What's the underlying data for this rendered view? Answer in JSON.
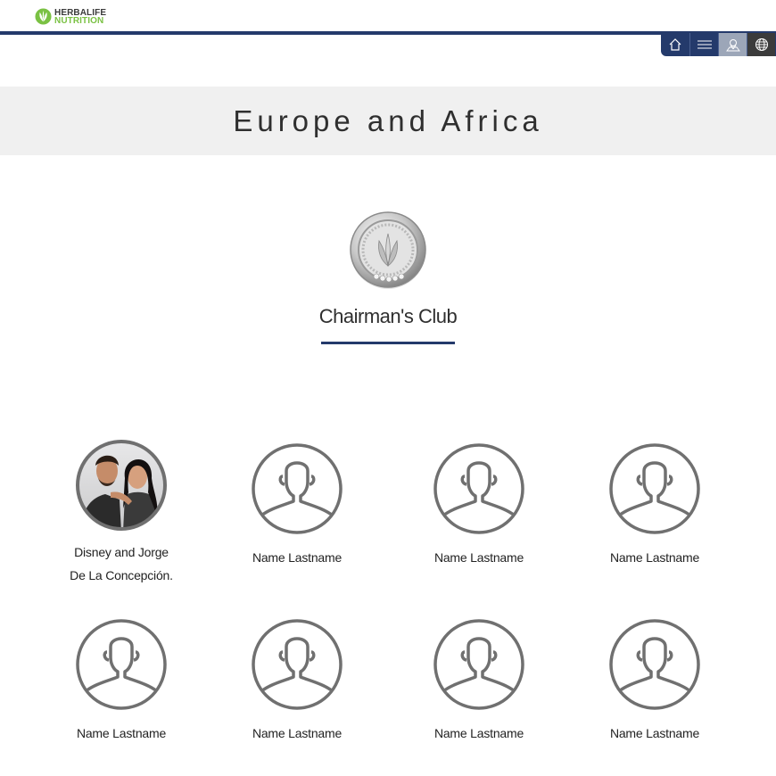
{
  "brand": {
    "line1": "HERBALIFE",
    "line2": "NUTRITION",
    "accent_color": "#7ac143",
    "nav_color": "#243a6b"
  },
  "nav": {
    "items": [
      {
        "icon": "home-icon"
      },
      {
        "icon": "menu-icon"
      },
      {
        "icon": "map-pin-icon"
      },
      {
        "icon": "globe-icon"
      }
    ]
  },
  "banner": {
    "title": "Europe and Africa"
  },
  "club": {
    "title": "Chairman's Club"
  },
  "members": [
    {
      "name_line1": "Disney and Jorge",
      "name_line2": "De La Concepción.",
      "has_photo": true
    },
    {
      "name_line1": "Name Lastname",
      "name_line2": "",
      "has_photo": false
    },
    {
      "name_line1": "Name Lastname",
      "name_line2": "",
      "has_photo": false
    },
    {
      "name_line1": "Name Lastname",
      "name_line2": "",
      "has_photo": false
    },
    {
      "name_line1": "Name Lastname",
      "name_line2": "",
      "has_photo": false
    },
    {
      "name_line1": "Name Lastname",
      "name_line2": "",
      "has_photo": false
    },
    {
      "name_line1": "Name Lastname",
      "name_line2": "",
      "has_photo": false
    },
    {
      "name_line1": "Name Lastname",
      "name_line2": "",
      "has_photo": false
    }
  ]
}
